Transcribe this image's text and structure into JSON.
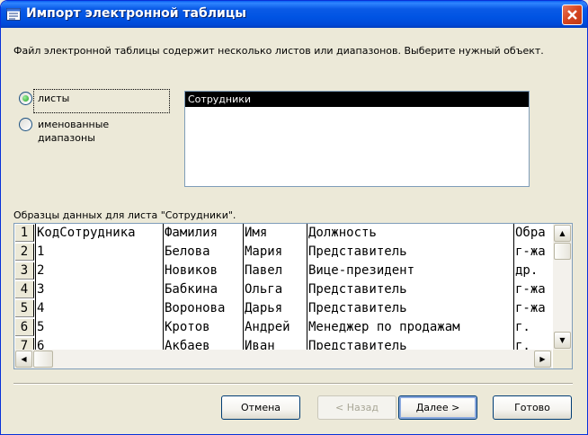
{
  "window": {
    "title": "Импорт электронной таблицы"
  },
  "instructions": "Файл электронной таблицы содержит несколько листов или диапазонов.  Выберите нужный объект.",
  "options": {
    "sheets_label": "листы",
    "ranges_label_line1": "именованные",
    "ranges_label_line2": "диапазоны",
    "selected": "sheets"
  },
  "objects_list": {
    "items": [
      "Сотрудники"
    ],
    "selected": "Сотрудники"
  },
  "sample_label": "Образцы данных для листа \"Сотрудники\".",
  "grid": {
    "rows": [
      {
        "n": "1",
        "c": [
          "КодСотрудника",
          "Фамилия",
          "Имя",
          "Должность",
          "Обра"
        ]
      },
      {
        "n": "2",
        "c": [
          "1",
          "Белова",
          "Мария",
          "Представитель",
          "г-жа"
        ]
      },
      {
        "n": "3",
        "c": [
          "2",
          "Новиков",
          "Павел",
          "Вице-президент",
          "др."
        ]
      },
      {
        "n": "4",
        "c": [
          "3",
          "Бабкина",
          "Ольга",
          "Представитель",
          "г-жа"
        ]
      },
      {
        "n": "5",
        "c": [
          "4",
          "Воронова",
          "Дарья",
          "Представитель",
          "г-жа"
        ]
      },
      {
        "n": "6",
        "c": [
          "5",
          "Кротов",
          "Андрей",
          "Менеджер по продажам",
          "г."
        ]
      },
      {
        "n": "7",
        "c": [
          "6",
          "Акбаев",
          "Иван",
          "Представитель",
          "г."
        ]
      }
    ]
  },
  "buttons": {
    "cancel": "Отмена",
    "back": "< Назад",
    "next": "Далее >",
    "finish": "Готово"
  },
  "colors": {
    "title_bar": "#0054e3",
    "dialog_bg": "#ece9d8",
    "selection": "#000000"
  }
}
